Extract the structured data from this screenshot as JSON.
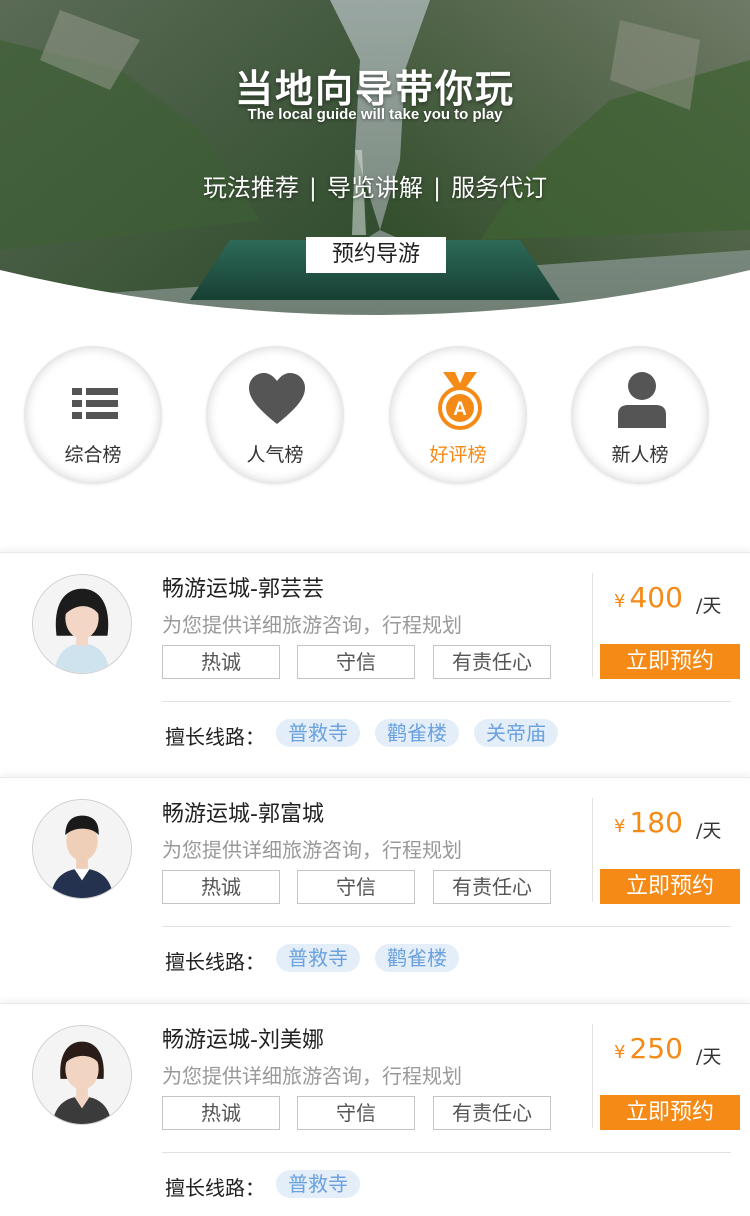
{
  "hero": {
    "title": "当地向导带你玩",
    "subtitle": "The local guide will take you to play",
    "features": [
      "玩法推荐",
      "导览讲解",
      "服务代订"
    ],
    "separator": "|",
    "book_button": "预约导游"
  },
  "rankings": [
    {
      "label": "综合榜",
      "icon": "list-icon",
      "active": false
    },
    {
      "label": "人气榜",
      "icon": "heart-icon",
      "active": false
    },
    {
      "label": "好评榜",
      "icon": "medal-icon",
      "active": true
    },
    {
      "label": "新人榜",
      "icon": "person-icon",
      "active": false
    }
  ],
  "guides": [
    {
      "name": "畅游运城-郭芸芸",
      "description": "为您提供详细旅游咨询，行程规划",
      "tags": [
        "热诚",
        "守信",
        "有责任心"
      ],
      "currency": "¥",
      "price": "400",
      "unit": "/天",
      "book_label": "立即预约",
      "routes_label": "擅长线路：",
      "routes": [
        "普救寺",
        "鹳雀楼",
        "关帝庙"
      ]
    },
    {
      "name": "畅游运城-郭富城",
      "description": "为您提供详细旅游咨询，行程规划",
      "tags": [
        "热诚",
        "守信",
        "有责任心"
      ],
      "currency": "¥",
      "price": "180",
      "unit": "/天",
      "book_label": "立即预约",
      "routes_label": "擅长线路：",
      "routes": [
        "普救寺",
        "鹳雀楼"
      ]
    },
    {
      "name": "畅游运城-刘美娜",
      "description": "为您提供详细旅游咨询，行程规划",
      "tags": [
        "热诚",
        "守信",
        "有责任心"
      ],
      "currency": "¥",
      "price": "250",
      "unit": "/天",
      "book_label": "立即预约",
      "routes_label": "擅长线路：",
      "routes": [
        "普救寺"
      ]
    }
  ],
  "colors": {
    "accent": "#f58a16",
    "route_tag_bg": "#e4eef9",
    "route_tag_text": "#6aa1de",
    "icon_gray": "#555555"
  }
}
